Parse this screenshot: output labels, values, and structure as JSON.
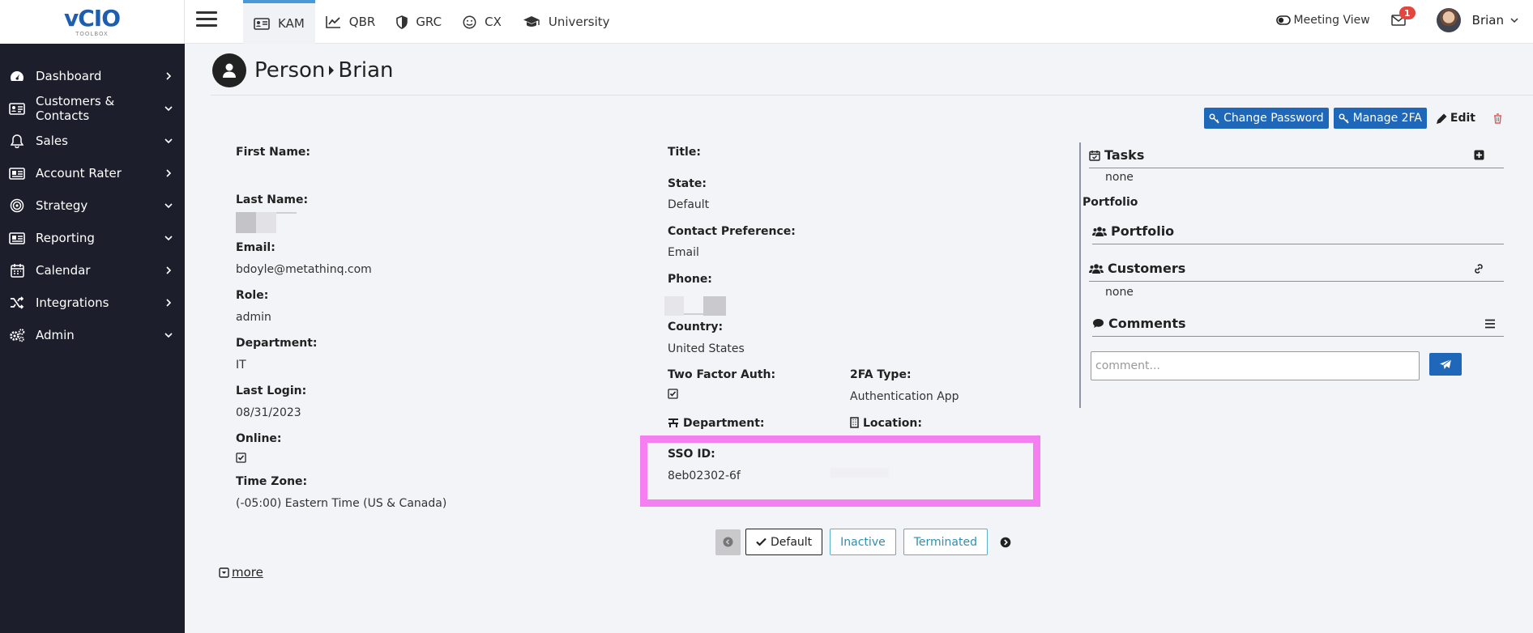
{
  "app": {
    "logo_text": "vCIO",
    "logo_sub": "TOOLBOX"
  },
  "sidebar": {
    "items": [
      {
        "label": "Dashboard",
        "icon": "gauge-icon",
        "chevron": "right"
      },
      {
        "label": "Customers & Contacts",
        "icon": "address-card-icon",
        "chevron": "down"
      },
      {
        "label": "Sales",
        "icon": "bell-icon",
        "chevron": "down"
      },
      {
        "label": "Account Rater",
        "icon": "rater-card-icon",
        "chevron": "right"
      },
      {
        "label": "Strategy",
        "icon": "target-icon",
        "chevron": "down"
      },
      {
        "label": "Reporting",
        "icon": "report-card-icon",
        "chevron": "down"
      },
      {
        "label": "Calendar",
        "icon": "calendar-icon",
        "chevron": "right"
      },
      {
        "label": "Integrations",
        "icon": "shuffle-icon",
        "chevron": "right"
      },
      {
        "label": "Admin",
        "icon": "gears-icon",
        "chevron": "down"
      }
    ]
  },
  "topnav": {
    "tabs": [
      {
        "label": "KAM",
        "icon": "id-card-icon",
        "active": true
      },
      {
        "label": "QBR",
        "icon": "line-chart-icon",
        "active": false
      },
      {
        "label": "GRC",
        "icon": "shield-icon",
        "active": false
      },
      {
        "label": "CX",
        "icon": "smile-icon",
        "active": false
      },
      {
        "label": "University",
        "icon": "graduation-cap-icon",
        "active": false
      }
    ],
    "meeting_view": "Meeting View",
    "mail_count": "1",
    "user_name": "Brian"
  },
  "page": {
    "breadcrumb_root": "Person",
    "breadcrumb_current": "Brian"
  },
  "actions": {
    "change_password": "Change Password",
    "manage_2fa": "Manage 2FA",
    "edit": "Edit"
  },
  "fields_left": {
    "first_name_label": "First Name:",
    "last_name_label": "Last Name:",
    "email_label": "Email:",
    "email_value": "bdoyle@metathinq.com",
    "role_label": "Role:",
    "role_value": "admin",
    "department_label": "Department:",
    "department_value": "IT",
    "last_login_label": "Last Login:",
    "last_login_value": "08/31/2023",
    "online_label": "Online:",
    "time_zone_label": "Time Zone:",
    "time_zone_value": "(-05:00) Eastern Time (US & Canada)"
  },
  "fields_mid": {
    "title_label": "Title:",
    "state_label": "State:",
    "state_value": "Default",
    "contact_pref_label": "Contact Preference:",
    "contact_pref_value": "Email",
    "phone_label": "Phone:",
    "country_label": "Country:",
    "country_value": "United States",
    "two_factor_label": "Two Factor Auth:",
    "two_fa_type_label": "2FA Type:",
    "two_fa_type_value": "Authentication App",
    "department_label": "Department:",
    "location_label": "Location:",
    "sso_label": "SSO ID:",
    "sso_value": "8eb02302-6f"
  },
  "status": {
    "default": "Default",
    "inactive": "Inactive",
    "terminated": "Terminated"
  },
  "more_label": "more",
  "right_panel": {
    "tasks_title": "Tasks",
    "tasks_empty": "none",
    "portfolio_label": "Portfolio",
    "portfolio_title": "Portfolio",
    "customers_title": "Customers",
    "customers_empty": "none",
    "comments_title": "Comments",
    "comment_placeholder": "comment..."
  },
  "colors": {
    "sidebar_bg": "#1c1f2b",
    "accent_blue": "#1f67b8",
    "highlight_pink": "#f57ff0",
    "badge_red": "#e2463f"
  }
}
